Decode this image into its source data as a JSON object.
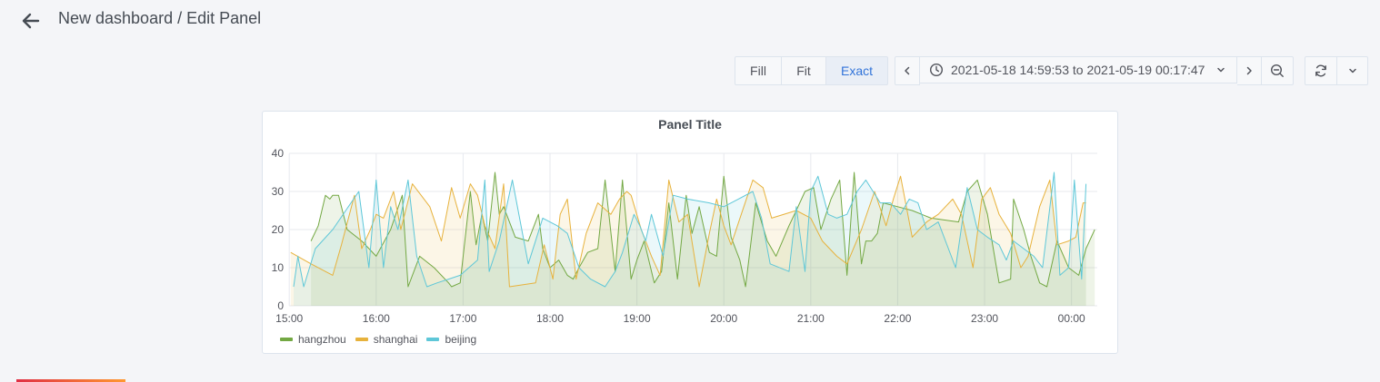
{
  "header": {
    "title": "New dashboard / Edit Panel"
  },
  "toolbar": {
    "modes": [
      {
        "label": "Fill",
        "active": false
      },
      {
        "label": "Fit",
        "active": false
      },
      {
        "label": "Exact",
        "active": true
      }
    ],
    "time_range": "2021-05-18 14:59:53 to 2021-05-19 00:17:47"
  },
  "icons": {
    "back": "arrow-left-icon",
    "time_prev": "chevron-left-icon",
    "clock": "clock-icon",
    "range_dropdown": "chevron-down-icon",
    "time_next": "chevron-right-icon",
    "zoom_out": "zoom-out-icon",
    "refresh": "sync-icon",
    "refresh_interval": "chevron-down-icon"
  },
  "colors": {
    "accent": "#3274d9",
    "hangzhou": "#73a843",
    "shanghai": "#e7b23c",
    "beijing": "#5ec7d8"
  },
  "panel": {
    "title": "Panel Title"
  },
  "chart_data": {
    "type": "line",
    "title": "Panel Title",
    "xlabel": "",
    "ylabel": "",
    "x_ticks": [
      "15:00",
      "16:00",
      "17:00",
      "18:00",
      "19:00",
      "20:00",
      "21:00",
      "22:00",
      "23:00",
      "00:00"
    ],
    "y_ticks": [
      "0",
      "10",
      "20",
      "30",
      "40"
    ],
    "xlim": [
      "14:59:53",
      "00:17:47"
    ],
    "ylim": [
      0,
      40
    ],
    "fill": true,
    "grid": true,
    "legend_position": "bottom-left",
    "series": [
      {
        "name": "hangzhou",
        "color": "#73a843",
        "points": [
          [
            "15:15",
            17
          ],
          [
            "15:20",
            21
          ],
          [
            "15:25",
            29
          ],
          [
            "15:28",
            28
          ],
          [
            "15:30",
            29
          ],
          [
            "15:34",
            29
          ],
          [
            "15:40",
            20
          ],
          [
            "15:50",
            17
          ],
          [
            "16:00",
            13
          ],
          [
            "16:10",
            20
          ],
          [
            "16:18",
            29
          ],
          [
            "16:22",
            5
          ],
          [
            "16:30",
            13
          ],
          [
            "16:40",
            10
          ],
          [
            "16:50",
            6
          ],
          [
            "16:52",
            5
          ],
          [
            "16:58",
            6
          ],
          [
            "17:05",
            30
          ],
          [
            "17:09",
            16
          ],
          [
            "17:13",
            24
          ],
          [
            "17:17",
            17
          ],
          [
            "17:22",
            35
          ],
          [
            "17:25",
            24
          ],
          [
            "17:28",
            26
          ],
          [
            "17:36",
            18
          ],
          [
            "17:45",
            17
          ],
          [
            "17:52",
            24
          ],
          [
            "17:55",
            15
          ],
          [
            "18:00",
            10
          ],
          [
            "18:06",
            12
          ],
          [
            "18:12",
            8
          ],
          [
            "18:16",
            7
          ],
          [
            "18:20",
            10
          ],
          [
            "18:26",
            14
          ],
          [
            "18:33",
            15
          ],
          [
            "18:38",
            33
          ],
          [
            "18:45",
            9
          ],
          [
            "18:50",
            33
          ],
          [
            "18:56",
            7
          ],
          [
            "19:00",
            12
          ],
          [
            "19:05",
            17
          ],
          [
            "19:12",
            6
          ],
          [
            "19:17",
            9
          ],
          [
            "19:22",
            27
          ],
          [
            "19:28",
            7
          ],
          [
            "19:34",
            29
          ],
          [
            "19:38",
            19
          ],
          [
            "19:43",
            26
          ],
          [
            "19:50",
            14
          ],
          [
            "19:55",
            13
          ],
          [
            "20:00",
            34
          ],
          [
            "20:05",
            18
          ],
          [
            "20:11",
            12
          ],
          [
            "20:15",
            5
          ],
          [
            "20:22",
            27
          ],
          [
            "20:30",
            17
          ],
          [
            "20:36",
            13
          ],
          [
            "20:45",
            21
          ],
          [
            "20:50",
            25
          ],
          [
            "20:56",
            30
          ],
          [
            "21:02",
            31
          ],
          [
            "21:07",
            20
          ],
          [
            "21:14",
            28
          ],
          [
            "21:20",
            33
          ],
          [
            "21:25",
            8
          ],
          [
            "21:30",
            35
          ],
          [
            "21:35",
            11
          ],
          [
            "21:38",
            17
          ],
          [
            "21:42",
            17
          ],
          [
            "21:46",
            19
          ],
          [
            "21:50",
            27
          ],
          [
            "22:00",
            26
          ],
          [
            "22:10",
            25
          ],
          [
            "22:23",
            23
          ],
          [
            "22:42",
            22
          ],
          [
            "22:48",
            30
          ],
          [
            "22:55",
            33
          ],
          [
            "23:02",
            24
          ],
          [
            "23:10",
            6
          ],
          [
            "23:18",
            7
          ],
          [
            "23:20",
            28
          ],
          [
            "23:27",
            20
          ],
          [
            "23:32",
            13
          ],
          [
            "23:38",
            6
          ],
          [
            "23:43",
            5
          ],
          [
            "23:50",
            17
          ],
          [
            "23:58",
            10
          ],
          [
            "00:05",
            8
          ],
          [
            "00:10",
            15
          ],
          [
            "00:16",
            20
          ]
        ]
      },
      {
        "name": "shanghai",
        "color": "#e7b23c",
        "points": [
          [
            "15:01",
            14
          ],
          [
            "15:15",
            11
          ],
          [
            "15:30",
            8
          ],
          [
            "15:36",
            16
          ],
          [
            "15:45",
            29
          ],
          [
            "15:50",
            15
          ],
          [
            "15:56",
            20
          ],
          [
            "16:00",
            24
          ],
          [
            "16:05",
            23
          ],
          [
            "16:12",
            30
          ],
          [
            "16:17",
            20
          ],
          [
            "16:25",
            32
          ],
          [
            "16:37",
            26
          ],
          [
            "16:45",
            17
          ],
          [
            "16:52",
            31
          ],
          [
            "16:58",
            23
          ],
          [
            "17:05",
            32
          ],
          [
            "17:10",
            29
          ],
          [
            "17:15",
            21
          ],
          [
            "17:22",
            15
          ],
          [
            "17:28",
            32
          ],
          [
            "17:32",
            5
          ],
          [
            "17:50",
            6
          ],
          [
            "17:56",
            16
          ],
          [
            "18:02",
            7
          ],
          [
            "18:07",
            24
          ],
          [
            "18:12",
            28
          ],
          [
            "18:18",
            7
          ],
          [
            "18:25",
            19
          ],
          [
            "18:33",
            27
          ],
          [
            "18:42",
            24
          ],
          [
            "18:48",
            28
          ],
          [
            "18:53",
            30
          ],
          [
            "18:56",
            29
          ],
          [
            "19:03",
            20
          ],
          [
            "19:10",
            13
          ],
          [
            "19:16",
            8
          ],
          [
            "19:22",
            33
          ],
          [
            "19:29",
            22
          ],
          [
            "19:35",
            24
          ],
          [
            "19:43",
            5
          ],
          [
            "19:50",
            19
          ],
          [
            "19:55",
            28
          ],
          [
            "20:00",
            21
          ],
          [
            "20:05",
            16
          ],
          [
            "20:12",
            24
          ],
          [
            "20:20",
            33
          ],
          [
            "20:27",
            31
          ],
          [
            "20:33",
            23
          ],
          [
            "20:50",
            25
          ],
          [
            "21:00",
            23
          ],
          [
            "21:08",
            17
          ],
          [
            "21:18",
            13
          ],
          [
            "21:25",
            11
          ],
          [
            "21:35",
            20
          ],
          [
            "21:44",
            30
          ],
          [
            "21:52",
            21
          ],
          [
            "21:57",
            28
          ],
          [
            "22:02",
            34
          ],
          [
            "22:10",
            18
          ],
          [
            "22:20",
            22
          ],
          [
            "22:28",
            24
          ],
          [
            "22:38",
            28
          ],
          [
            "22:44",
            24
          ],
          [
            "22:52",
            10
          ],
          [
            "22:58",
            28
          ],
          [
            "23:04",
            31
          ],
          [
            "23:10",
            24
          ],
          [
            "23:18",
            19
          ],
          [
            "23:25",
            10
          ],
          [
            "23:30",
            13
          ],
          [
            "23:38",
            26
          ],
          [
            "23:45",
            33
          ],
          [
            "23:50",
            16
          ],
          [
            "23:58",
            17
          ],
          [
            "00:03",
            18
          ],
          [
            "00:08",
            27
          ],
          [
            "00:10",
            27
          ]
        ]
      },
      {
        "name": "beijing",
        "color": "#5ec7d8",
        "points": [
          [
            "15:03",
            5
          ],
          [
            "15:06",
            13
          ],
          [
            "15:10",
            5
          ],
          [
            "15:18",
            15
          ],
          [
            "15:30",
            20
          ],
          [
            "15:48",
            30
          ],
          [
            "15:55",
            10
          ],
          [
            "16:00",
            33
          ],
          [
            "16:05",
            10
          ],
          [
            "16:10",
            26
          ],
          [
            "16:15",
            20
          ],
          [
            "16:22",
            33
          ],
          [
            "16:28",
            13
          ],
          [
            "16:35",
            5
          ],
          [
            "16:42",
            6
          ],
          [
            "16:50",
            7
          ],
          [
            "16:58",
            8
          ],
          [
            "17:10",
            12
          ],
          [
            "17:15",
            33
          ],
          [
            "17:18",
            9
          ],
          [
            "17:25",
            17
          ],
          [
            "17:34",
            33
          ],
          [
            "17:45",
            11
          ],
          [
            "17:55",
            23
          ],
          [
            "18:05",
            21
          ],
          [
            "18:12",
            19
          ],
          [
            "18:20",
            10
          ],
          [
            "18:28",
            7
          ],
          [
            "18:38",
            5
          ],
          [
            "18:45",
            9
          ],
          [
            "18:50",
            14
          ],
          [
            "18:58",
            24
          ],
          [
            "19:02",
            21
          ],
          [
            "19:06",
            17
          ],
          [
            "19:10",
            24
          ],
          [
            "19:18",
            13
          ],
          [
            "19:25",
            29
          ],
          [
            "19:35",
            28
          ],
          [
            "19:50",
            27
          ],
          [
            "20:00",
            26
          ],
          [
            "20:10",
            28
          ],
          [
            "20:20",
            30
          ],
          [
            "20:26",
            23
          ],
          [
            "20:32",
            11
          ],
          [
            "20:45",
            9
          ],
          [
            "20:50",
            26
          ],
          [
            "20:56",
            9
          ],
          [
            "21:00",
            30
          ],
          [
            "21:05",
            34
          ],
          [
            "21:12",
            24
          ],
          [
            "21:18",
            23
          ],
          [
            "21:25",
            24
          ],
          [
            "21:32",
            30
          ],
          [
            "21:38",
            33
          ],
          [
            "21:48",
            27
          ],
          [
            "21:55",
            27
          ],
          [
            "22:02",
            24
          ],
          [
            "22:08",
            28
          ],
          [
            "22:14",
            27
          ],
          [
            "22:20",
            20
          ],
          [
            "22:28",
            22
          ],
          [
            "22:40",
            10
          ],
          [
            "22:48",
            31
          ],
          [
            "22:55",
            20
          ],
          [
            "23:02",
            18
          ],
          [
            "23:10",
            16
          ],
          [
            "23:15",
            12
          ],
          [
            "23:20",
            17
          ],
          [
            "23:34",
            13
          ],
          [
            "23:40",
            10
          ],
          [
            "23:48",
            35
          ],
          [
            "23:52",
            8
          ],
          [
            "23:58",
            10
          ],
          [
            "00:02",
            33
          ],
          [
            "00:07",
            7
          ],
          [
            "00:10",
            32
          ]
        ]
      }
    ]
  }
}
